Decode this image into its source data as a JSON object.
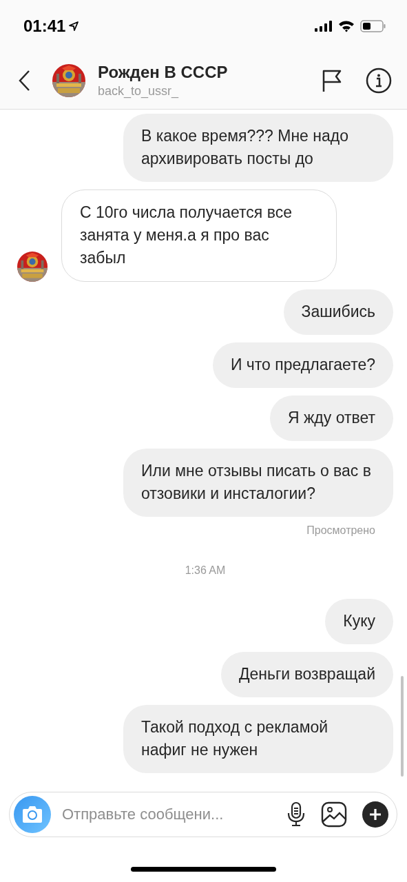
{
  "status_bar": {
    "time": "01:41"
  },
  "header": {
    "title": "Рожден В СССР",
    "username": "back_to_ussr_"
  },
  "messages": [
    {
      "kind": "outgoing",
      "text": "В какое время??? Мне надо архивировать посты до"
    },
    {
      "kind": "incoming",
      "text": "С 10го числа получается все занята у меня.а я про вас забыл"
    },
    {
      "kind": "outgoing",
      "text": "Зашибись"
    },
    {
      "kind": "outgoing",
      "text": "И что предлагаете?"
    },
    {
      "kind": "outgoing",
      "text": "Я жду ответ"
    },
    {
      "kind": "outgoing",
      "text": "Или мне отзывы писать о вас в отзовики и инсталогии?"
    },
    {
      "kind": "status",
      "text": "Просмотрено"
    },
    {
      "kind": "time",
      "text": "1:36 AM"
    },
    {
      "kind": "outgoing",
      "text": "Куку"
    },
    {
      "kind": "outgoing",
      "text": "Деньги возвращай"
    },
    {
      "kind": "outgoing",
      "text": "Такой подход с рекламой нафиг не нужен"
    }
  ],
  "composer": {
    "placeholder": "Отправьте сообщени..."
  }
}
